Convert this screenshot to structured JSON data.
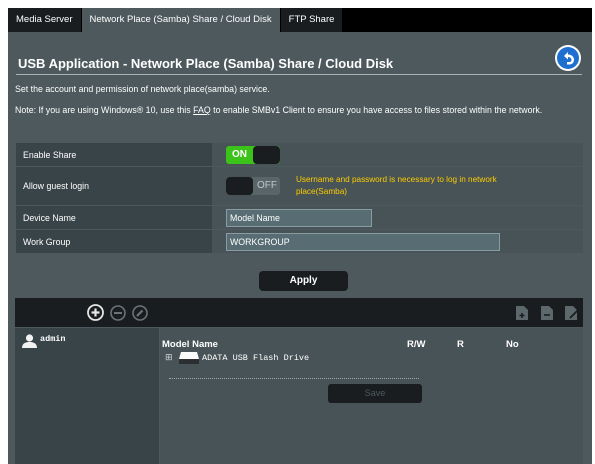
{
  "tabs": [
    {
      "label": "Media Server"
    },
    {
      "label": "Network Place (Samba) Share / Cloud Disk"
    },
    {
      "label": "FTP Share"
    }
  ],
  "title": "USB Application - Network Place (Samba) Share / Cloud Disk",
  "desc1": "Set the account and permission of network place(samba) service.",
  "note_prefix": "Note: If you are using Windows® 10, use this ",
  "note_link": "FAQ",
  "note_suffix": " to enable SMBv1 Client to ensure you have access to files stored within the network.",
  "settings": {
    "enable_share_label": "Enable Share",
    "enable_share_state": "ON",
    "guest_label": "Allow guest login",
    "guest_state": "OFF",
    "guest_warning": "Username and password is necessary to log in network place(Samba)",
    "device_name_label": "Device Name",
    "device_name_value": "Model Name",
    "work_group_label": "Work Group",
    "work_group_value": "WORKGROUP"
  },
  "apply_label": "Apply",
  "accounts": [
    {
      "name": "admin"
    }
  ],
  "folder_table": {
    "headers": {
      "name": "Model Name",
      "rw": "R/W",
      "r": "R",
      "no": "No"
    },
    "items": [
      {
        "name": "ADATA USB Flash Drive"
      }
    ]
  },
  "save_label": "Save",
  "colors": {
    "accent_on": "#3bc31a",
    "warning": "#ffcc00",
    "panel": "#4d595d"
  }
}
